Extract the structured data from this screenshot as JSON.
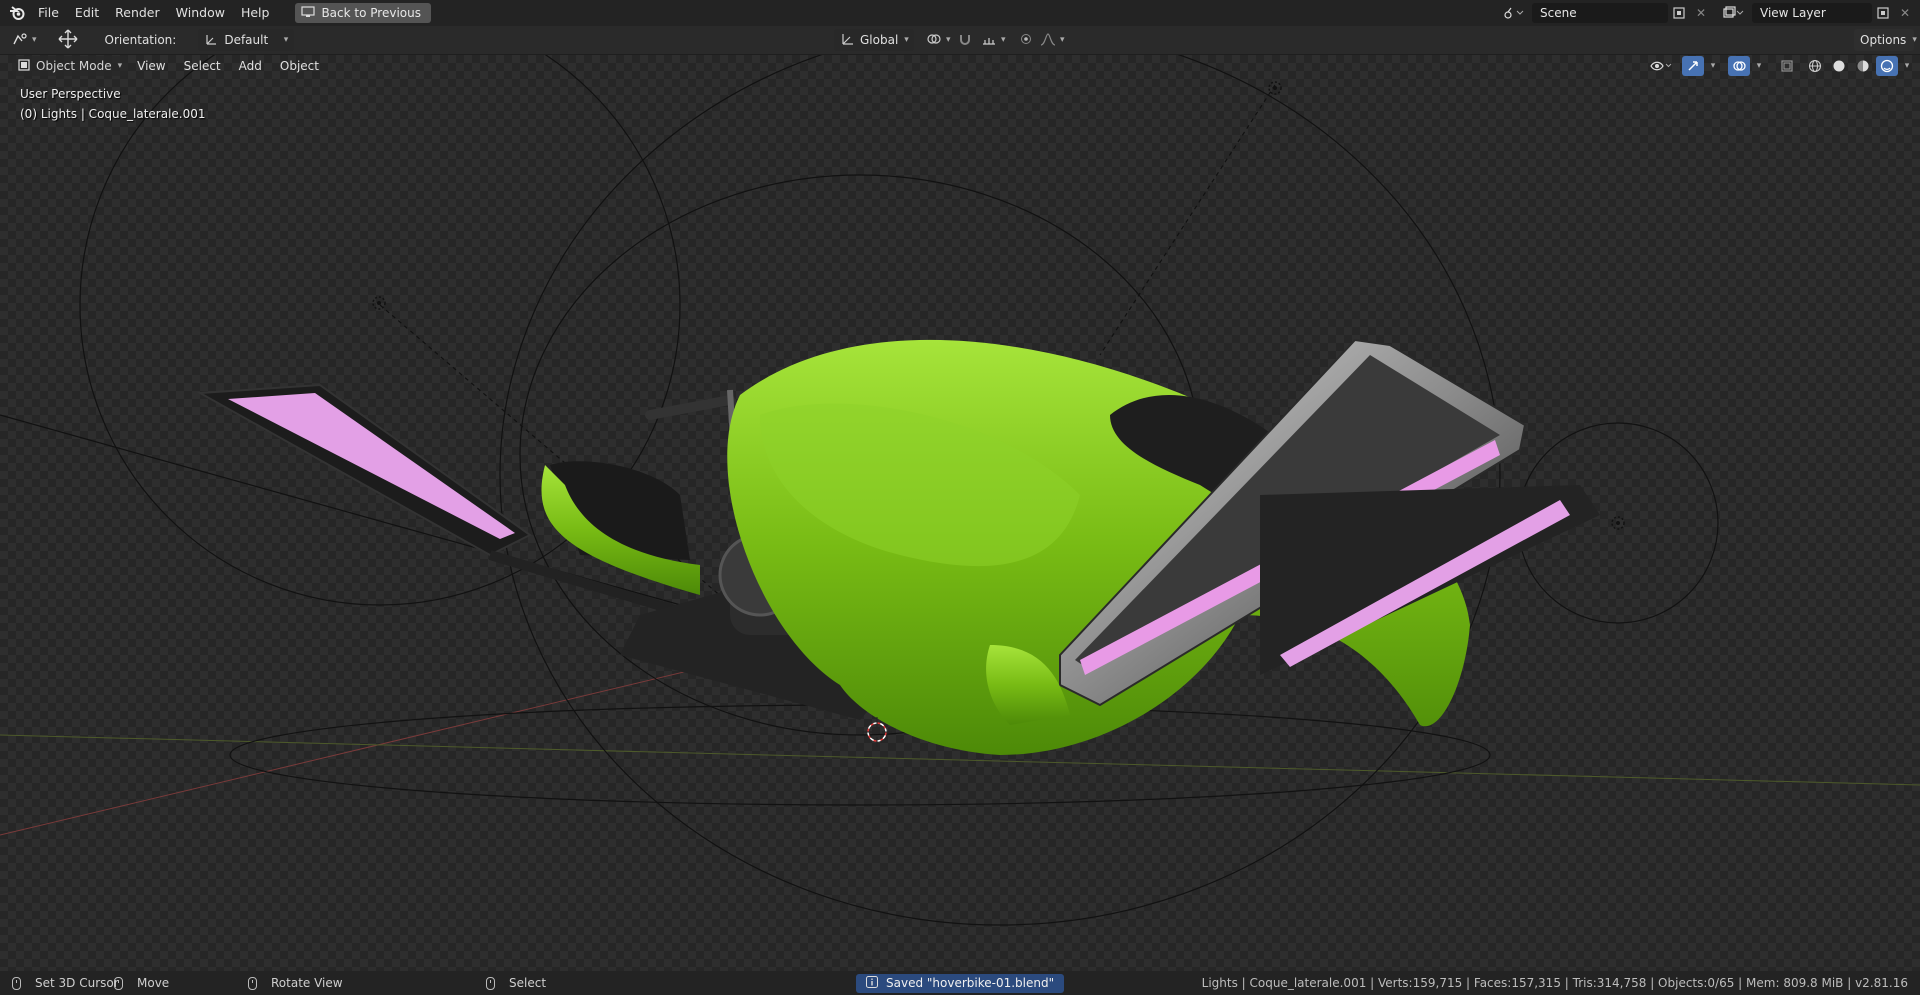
{
  "topbar": {
    "menus": [
      "File",
      "Edit",
      "Render",
      "Window",
      "Help"
    ],
    "back_button": "Back to Previous",
    "scene_name": "Scene",
    "view_layer": "View Layer"
  },
  "toolbar": {
    "orientation_label": "Orientation:",
    "orientation_value": "Default",
    "transform_space": "Global",
    "options_label": "Options"
  },
  "viewport": {
    "mode": "Object Mode",
    "menus": [
      "View",
      "Select",
      "Add",
      "Object"
    ],
    "perspective_label": "User Perspective",
    "context_label": "(0) Lights | Coque_laterale.001"
  },
  "statusbar": {
    "hint_cursor": "Set 3D Cursor",
    "hint_move": "Move",
    "hint_rotate": "Rotate View",
    "hint_select": "Select",
    "saved_message": "Saved \"hoverbike-01.blend\"",
    "stats": "Lights | Coque_laterale.001 | Verts:159,715 | Faces:157,315 | Tris:314,758 | Objects:0/65 | Mem: 809.8 MiB | v2.81.16"
  },
  "colors": {
    "accent_blue": "#4772b3",
    "hull_green": "#7fc31c",
    "neon_pink": "#e89ae6"
  }
}
